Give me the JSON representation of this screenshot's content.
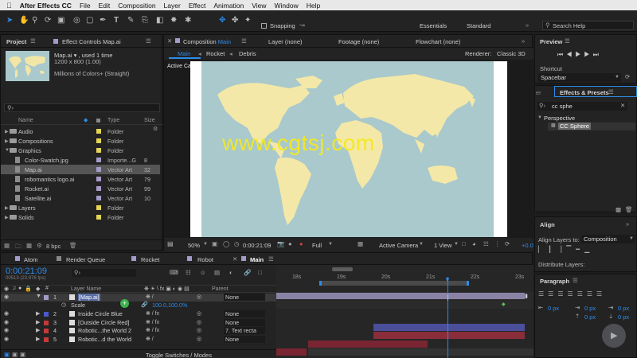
{
  "menubar": {
    "apple": "",
    "app": "After Effects CC",
    "items": [
      "File",
      "Edit",
      "Composition",
      "Layer",
      "Effect",
      "Animation",
      "View",
      "Window",
      "Help"
    ]
  },
  "toolbar": {
    "snapping": "Snapping",
    "workspaces": [
      "Essentials",
      "Standard"
    ],
    "search_help": "Search Help"
  },
  "project": {
    "tab": "Project",
    "effect_controls_tab": "Effect Controls Map.ai",
    "thumb_name": "Map.ai ▾ , used 1 time",
    "thumb_size": "1200 x 800 (1.00)",
    "thumb_colors": "Millions of Colors+ (Straight)",
    "search_placeholder": "",
    "col_name": "Name",
    "col_type": "Type",
    "col_size": "Size",
    "rows": [
      {
        "name": "Audio",
        "type": "Folder",
        "size": "",
        "kind": "folder",
        "label": "#e3d555"
      },
      {
        "name": "Compositions",
        "type": "Folder",
        "size": "",
        "kind": "folder",
        "label": "#e3d555"
      },
      {
        "name": "Graphics",
        "type": "Folder",
        "size": "",
        "kind": "folder",
        "label": "#e3d555"
      },
      {
        "name": "Color-Swatch.jpg",
        "type": "Importe...G",
        "size": "8",
        "kind": "file",
        "label": "#a69ac9"
      },
      {
        "name": "Map.ai",
        "type": "Vector Art",
        "size": "32",
        "kind": "file",
        "label": "#a69ac9"
      },
      {
        "name": "robomantics logo.ai",
        "type": "Vector Art",
        "size": "79",
        "kind": "file",
        "label": "#a69ac9"
      },
      {
        "name": "Rocket.ai",
        "type": "Vector Art",
        "size": "99",
        "kind": "file",
        "label": "#a69ac9"
      },
      {
        "name": "Satellite.ai",
        "type": "Vector Art",
        "size": "10",
        "kind": "file",
        "label": "#a69ac9"
      },
      {
        "name": "Layers",
        "type": "Folder",
        "size": "",
        "kind": "folder",
        "label": "#e3d555"
      },
      {
        "name": "Solids",
        "type": "Folder",
        "size": "",
        "kind": "folder",
        "label": "#e3d555"
      }
    ],
    "bpc": "8 bpc"
  },
  "comp": {
    "tab": "Composition",
    "tab_comp": "Main",
    "layer_tab": "Layer (none)",
    "footage_tab": "Footage (none)",
    "flowchart_tab": "Flowchart (none)",
    "nav": [
      "Main",
      "Rocket",
      "Debris"
    ],
    "renderer_label": "Renderer:",
    "renderer": "Classic 3D",
    "active_camera_label": "Active Camera",
    "watermark": "www.cgtsj.com",
    "zoom": "50%",
    "time": "0:00:21:09",
    "resolution": "Full",
    "camera": "Active Camera",
    "view": "1 View",
    "exposure": "+0.0"
  },
  "right": {
    "preview_tab": "Preview",
    "shortcut_label": "Shortcut",
    "shortcut_value": "Spacebar",
    "effects_tab": "Effects & Presets",
    "effects_search": "cc sphe",
    "category": "Perspective",
    "effect_item": "CC Sphere",
    "align_tab": "Align",
    "align_to_label": "Align Layers to:",
    "align_to_value": "Composition",
    "distribute_label": "Distribute Layers:",
    "paragraph_tab": "Paragraph",
    "px_values": [
      "0 px",
      "0 px",
      "0 px",
      "0 px",
      "0 px"
    ]
  },
  "timeline": {
    "tabs": [
      "Atom",
      "Render Queue",
      "Rocket",
      "Robot",
      "Main"
    ],
    "timecode": "0:00:21:09",
    "frames": "00513 (23.976 fps)",
    "col_layer_name": "Layer Name",
    "col_parent": "Parent",
    "ruler": [
      "18s",
      "19s",
      "20s",
      "21s",
      "22s",
      "23s"
    ],
    "layers": [
      {
        "num": "1",
        "name": "[Map.ai]",
        "parent": "None",
        "color": "#a69ac9",
        "selected": true
      },
      {
        "num": "2",
        "name": "Inside Circle Blue",
        "parent": "None",
        "color": "#4b59c9",
        "selected": false
      },
      {
        "num": "3",
        "name": "[Outside Circle Red]",
        "parent": "None",
        "color": "#c23a3a",
        "selected": false
      },
      {
        "num": "4",
        "name": "Robotic...the World 2",
        "parent": "7. Text recta",
        "color": "#c23a3a",
        "selected": false
      },
      {
        "num": "5",
        "name": "Robotic...d the World",
        "parent": "None",
        "color": "#c23a3a",
        "selected": false
      }
    ],
    "scale_label": "Scale",
    "scale_value": "100.0,100.0%",
    "footer": "Toggle Switches / Modes"
  }
}
